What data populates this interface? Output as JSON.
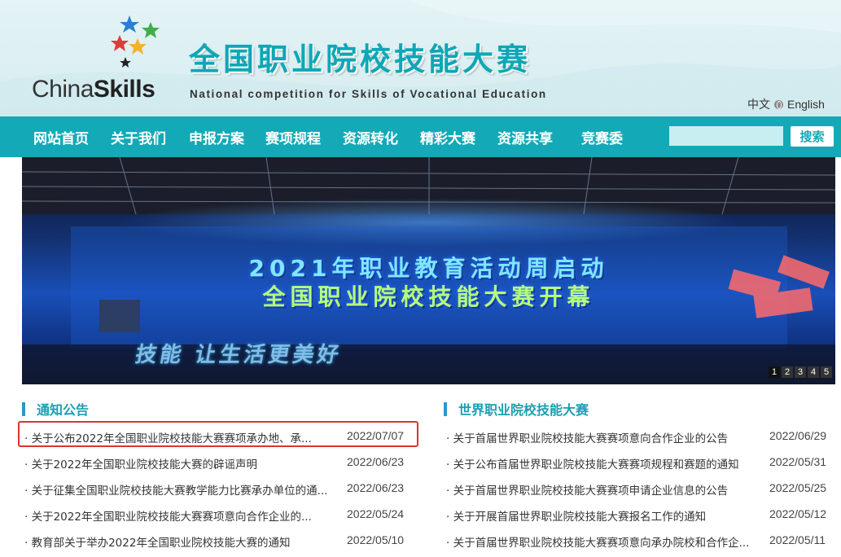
{
  "header": {
    "logo_text_1": "China",
    "logo_text_2": "Skills",
    "title": "全国职业院校技能大赛",
    "subtitle": "National competition for Skills of Vocational Education",
    "lang_cn": "中文",
    "lang_en": "English"
  },
  "nav": {
    "items": [
      "网站首页",
      "关于我们",
      "申报方案",
      "赛项规程",
      "资源转化",
      "精彩大赛",
      "资源共享",
      "竞赛委"
    ],
    "search_placeholder": "",
    "search_label": "搜索"
  },
  "banner": {
    "line1": "2021年职业教育活动周启动",
    "line2": "全国职业院校技能大赛开幕",
    "line3": "技能 让生活更美好",
    "pages": [
      "1",
      "2",
      "3",
      "4",
      "5"
    ],
    "active_page": "1"
  },
  "notices": {
    "title": "通知公告",
    "items": [
      {
        "title": "· 关于公布2022年全国职业院校技能大赛赛项承办地、承...",
        "date": "2022/07/07"
      },
      {
        "title": "· 关于2022年全国职业院校技能大赛的辟谣声明",
        "date": "2022/06/23"
      },
      {
        "title": "· 关于征集全国职业院校技能大赛教学能力比赛承办单位的通...",
        "date": "2022/06/23"
      },
      {
        "title": "· 关于2022年全国职业院校技能大赛赛项意向合作企业的...",
        "date": "2022/05/24"
      },
      {
        "title": "· 教育部关于举办2022年全国职业院校技能大赛的通知",
        "date": "2022/05/10"
      }
    ]
  },
  "world": {
    "title": "世界职业院校技能大赛",
    "items": [
      {
        "title": "· 关于首届世界职业院校技能大赛赛项意向合作企业的公告",
        "date": "2022/06/29"
      },
      {
        "title": "· 关于公布首届世界职业院校技能大赛赛项规程和赛题的通知",
        "date": "2022/05/31"
      },
      {
        "title": "· 关于首届世界职业院校技能大赛赛项申请企业信息的公告",
        "date": "2022/05/25"
      },
      {
        "title": "· 关于开展首届世界职业院校技能大赛报名工作的通知",
        "date": "2022/05/12"
      },
      {
        "title": "· 关于首届世界职业院校技能大赛赛项意向承办院校和合作企...",
        "date": "2022/05/11"
      }
    ]
  },
  "colors": {
    "accent": "#14a9b7",
    "title_text": "#0ea7b6",
    "highlight": "#e0322f"
  }
}
